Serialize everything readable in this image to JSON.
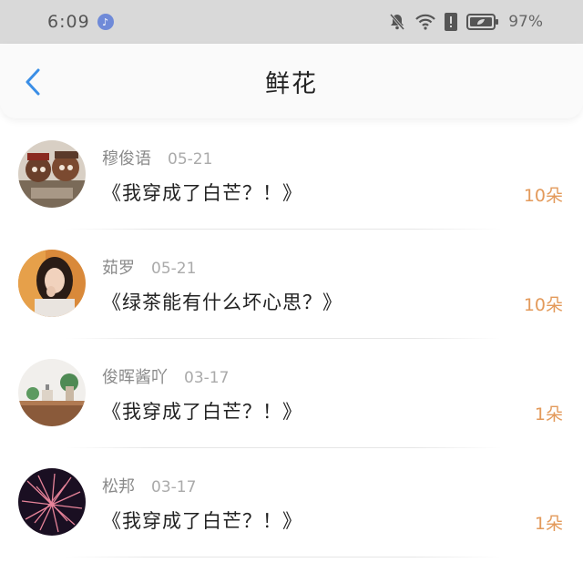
{
  "status_bar": {
    "time": "6:09",
    "battery_percent": "97%"
  },
  "header": {
    "title": "鲜花"
  },
  "records": [
    {
      "name": "穆俊语",
      "date": "05-21",
      "work": "《我穿成了白芒？！》",
      "count": "10朵"
    },
    {
      "name": "茹罗",
      "date": "05-21",
      "work": "《绿茶能有什么坏心思？》",
      "count": "10朵"
    },
    {
      "name": "俊晖酱吖",
      "date": "03-17",
      "work": "《我穿成了白芒？！》",
      "count": "1朵"
    },
    {
      "name": "松邦",
      "date": "03-17",
      "work": "《我穿成了白芒？！》",
      "count": "1朵"
    }
  ],
  "colors": {
    "accent_blue": "#3a8ee6",
    "count_orange": "#e39a5b"
  }
}
